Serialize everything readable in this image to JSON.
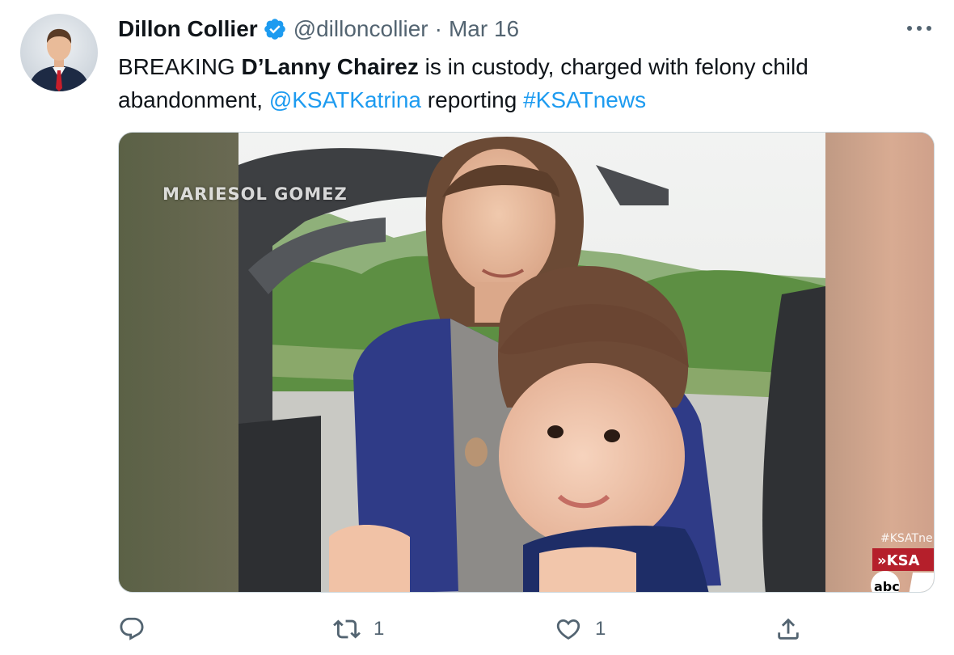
{
  "tweet": {
    "author_name": "Dillon Collier",
    "author_handle": "@dilloncollier",
    "separator": "·",
    "date": "Mar 16",
    "text": {
      "part1": "BREAKING ",
      "bold_name": "D’Lanny Chairez",
      "part2": " is in custody, charged with felony child abandonment, ",
      "mention": "@KSATKatrina",
      "part3": " reporting ",
      "hashtag": "#KSATnews"
    }
  },
  "media": {
    "watermark": "MARIESOL GOMEZ",
    "overlay_hashtag": "#KSATne",
    "station_logo_text": "»KSA",
    "network_logo_text": "abc"
  },
  "actions": {
    "reply_count": "",
    "retweet_count": "1",
    "like_count": "1"
  },
  "colors": {
    "link": "#1d9bf0",
    "secondary_text": "#536471",
    "verified_badge": "#1d9bf0"
  },
  "icons": {
    "verified": "verified-badge-icon",
    "more": "more-dots-icon",
    "reply": "reply-icon",
    "retweet": "retweet-icon",
    "like": "heart-icon",
    "share": "share-icon"
  }
}
